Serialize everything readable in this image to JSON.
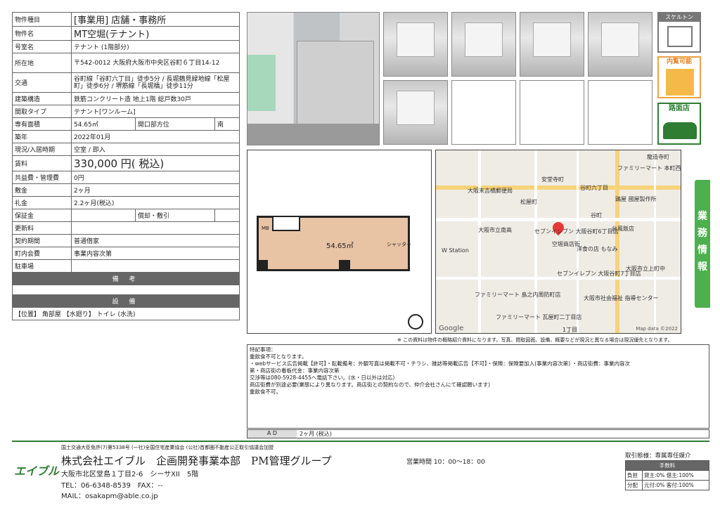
{
  "spec": {
    "rows": [
      {
        "k": "物件種目",
        "v": "[事業用] 店舗・事務所",
        "cls": "big"
      },
      {
        "k": "物件名",
        "v": "MT空堀(テナント)",
        "cls": "big"
      },
      {
        "k": "号室名",
        "v": "テナント (1階部分)"
      },
      {
        "k": "所在地",
        "v": "〒542-0012 大阪府大阪市中央区谷町６丁目14-12"
      },
      {
        "k": "交通",
        "v": "谷町線「谷町六丁目」徒歩5分 / 長堀鶴見緑地線「松屋町」徒歩6分 / 堺筋線「長堀橋」徒歩11分"
      },
      {
        "k": "建築構造",
        "v": "鉄筋コンクリート造 地上1階 総戸数30戸"
      },
      {
        "k": "間取タイプ",
        "v": "テナント[ワンルーム]"
      },
      {
        "k": "専有面積",
        "v": "54.65㎡",
        "k2": "開口部方位",
        "v2": "南"
      },
      {
        "k": "築年",
        "v": "2022年01月"
      },
      {
        "k": "現況/入居時期",
        "v": "空室 / 即入"
      },
      {
        "k": "賃料",
        "v": "330,000 円( 税込)",
        "cls": "rent"
      },
      {
        "k": "共益費・管理費",
        "v": "0円"
      },
      {
        "k": "敷金",
        "v": "2ヶ月"
      },
      {
        "k": "礼金",
        "v": "2.2ヶ月(税込)"
      },
      {
        "k": "保証金",
        "v": "",
        "k2": "償却・敷引",
        "v2": ""
      },
      {
        "k": "更新料",
        "v": ""
      },
      {
        "k": "契約期間",
        "v": "普通借家"
      },
      {
        "k": "町内会費",
        "v": "事業内容次第"
      },
      {
        "k": "駐車場",
        "v": ""
      }
    ],
    "bikou_label": "備 考",
    "setsubi_label": "設 備",
    "setsubi_text": "【位置】 角部屋 【水廻り】 トイレ (水洗)"
  },
  "badges": {
    "skeleton": "スケルトン",
    "viewing": "内覧可能",
    "roadside": "路面店"
  },
  "floorplan": {
    "area": "54.65㎡",
    "shutter": "シャッター",
    "mb": "MB"
  },
  "map": {
    "labels": [
      "龍造寺町",
      "ファミリーマート 本町西一丁目店",
      "安堂寺町",
      "大阪末吉橋郵便局",
      "谷町六丁目",
      "松屋町",
      "鶏屋 國屋製作所",
      "谷町",
      "大阪市立南高",
      "セブンイレブン 大阪谷町6丁目店",
      "台風飯店",
      "空堀商店街",
      "洋食の店 もなみ",
      "W Station",
      "セブンイレブン 大阪谷町7丁目店",
      "大阪市立上町中",
      "ファミリーマート 島之内周防町店",
      "大阪市社会福祉 指導センター",
      "ファミリーマート 瓦屋町二丁目店",
      "1丁目"
    ],
    "google": "Google",
    "copyright": "Map data ©2022"
  },
  "disclaimer": "※ この資料は物件の概略紹介資料になります。写真、間取図面、設備、概要などが現況と異なる場合は現況優先となります。",
  "notes": [
    "特記事項：",
    "重飲食不可となります。",
    "・webサービス広告掲載【許可】・転載備考：外観写真は掲載不可・チラシ、雑誌等掲載広告【不可】・保険：保険要加入(事業内容次第) ・商店街費：事業内容次",
    "第・商店街の看板代金：事業内容次第",
    "交渉等は080-5928-4455へ電話下さい。(水・日以外は対応)",
    "商店街費が別途必要(業態により異なります。商店街との契約なので、仲介会社さんにて確認願います)",
    "重飲食不可。"
  ],
  "ad": {
    "label": "A D",
    "value": "2ヶ月 (税込)"
  },
  "side_label": "業務情報",
  "footer": {
    "license": "国土交通大臣免許(7)第5338号 (一社)全国住宅産業協会 (公社)首都圏不動産公正取引協議会加盟",
    "logo": "エイブル",
    "company": "株式会社エイブル　企画開発事業本部　PM管理グループ",
    "hours": "営業時間 10：00～18：00",
    "address": "大阪市北区堂島１丁目2-6　シーサXII　5階",
    "tel": "TEL：06-6348-8539　FAX：--",
    "mail": "MAIL：osakapm@able.co.jp"
  },
  "fees": {
    "title": "取引態様：専属専任媒介",
    "header": "手数料",
    "rows": [
      {
        "k": "負担",
        "v": "貸主:0% 借主:100%"
      },
      {
        "k": "分配",
        "v": "元付:0% 客付:100%"
      }
    ]
  }
}
